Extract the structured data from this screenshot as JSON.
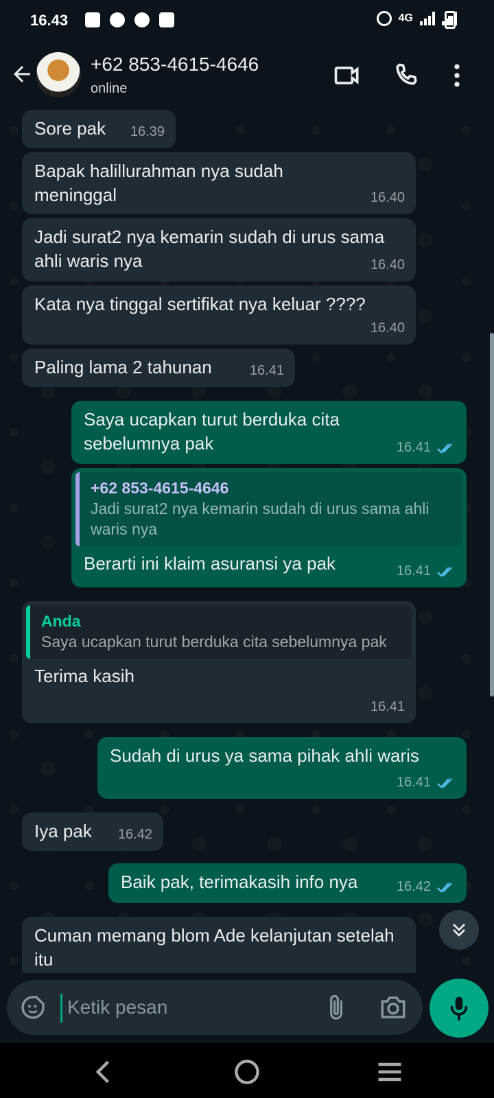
{
  "status_bar": {
    "time": "16.43",
    "network": "4G",
    "icons": [
      "bag-icon",
      "search-icon",
      "d-app-icon",
      "ge-icon",
      "alarm-icon",
      "signal-icon",
      "signal-icon",
      "battery-icon"
    ]
  },
  "header": {
    "name": "+62 853-4615-4646",
    "status": "online",
    "icons": [
      "back-arrow-icon",
      "avatar",
      "video-call-icon",
      "phone-icon",
      "more-vert-icon"
    ]
  },
  "messages": [
    {
      "direction": "in",
      "text": "Sore pak",
      "time": "16.39"
    },
    {
      "direction": "in",
      "text": "Bapak halillurahman nya sudah meninggal",
      "time": "16.40"
    },
    {
      "direction": "in",
      "text": "Jadi surat2 nya kemarin sudah di urus sama ahli waris nya",
      "time": "16.40"
    },
    {
      "direction": "in",
      "text": "Kata nya tinggal sertifikat nya keluar ????",
      "time": "16.40"
    },
    {
      "direction": "in",
      "text": "Paling lama 2 tahunan",
      "time": "16.41"
    },
    {
      "direction": "out",
      "text": "Saya ucapkan turut berduka cita sebelumnya pak",
      "time": "16.41",
      "read": true
    },
    {
      "direction": "out",
      "quote_author": "+62 853-4615-4646",
      "quote_text": "Jadi surat2 nya kemarin sudah di urus sama ahli waris nya",
      "text": "Berarti ini klaim asuransi ya pak",
      "time": "16.41",
      "read": true
    },
    {
      "direction": "in",
      "quote_author": "Anda",
      "quote_text": "Saya ucapkan turut berduka cita sebelumnya pak",
      "text": "Terima kasih",
      "time": "16.41"
    },
    {
      "direction": "out",
      "text": "Sudah di urus ya sama pihak ahli waris",
      "time": "16.41",
      "read": true
    },
    {
      "direction": "in",
      "text": "Iya pak",
      "time": "16.42"
    },
    {
      "direction": "out",
      "text": "Baik pak, terimakasih info nya",
      "time": "16.42",
      "read": true
    },
    {
      "direction": "in",
      "text": "Cuman memang blom Ade kelanjutan setelah itu",
      "time": ""
    }
  ],
  "input": {
    "placeholder": "Ketik pesan",
    "value": ""
  },
  "colors": {
    "background": "#0b141a",
    "incoming_bubble": "#202c33",
    "outgoing_bubble": "#005c4b",
    "accent": "#00a884",
    "read_ticks": "#53bdeb"
  }
}
